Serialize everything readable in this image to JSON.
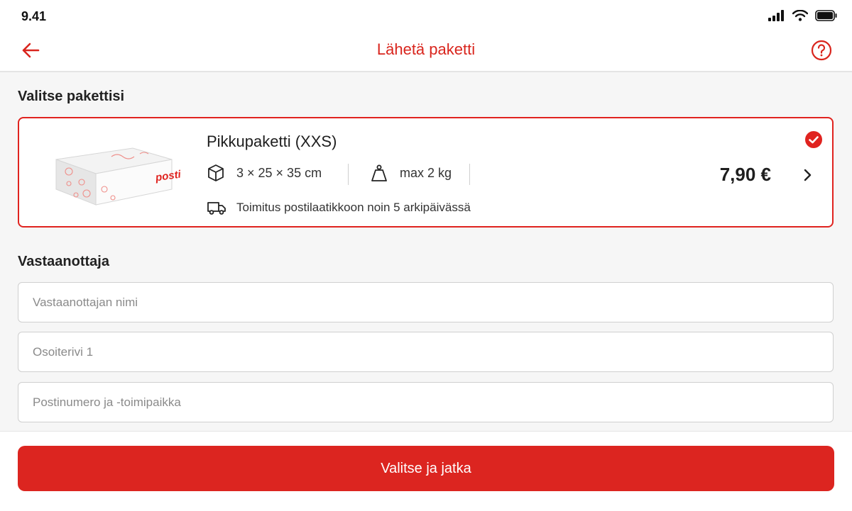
{
  "status_bar": {
    "time": "9.41"
  },
  "nav": {
    "title": "Lähetä paketti",
    "back_icon": "arrow-left-icon",
    "help_icon": "question-circle-icon"
  },
  "colors": {
    "accent": "#dc2520",
    "border": "#e0231f"
  },
  "package_section": {
    "title": "Valitse pakettisi",
    "package": {
      "name": "Pikkupaketti (XXS)",
      "dimensions": "3 × 25 × 35 cm",
      "weight": "max 2 kg",
      "delivery": "Toimitus postilaatikkoon noin 5 arkipäivässä",
      "price": "7,90 €",
      "box_brand": "posti",
      "selected": true
    }
  },
  "recipient_section": {
    "title": "Vastaanottaja",
    "fields": {
      "name": {
        "placeholder": "Vastaanottajan nimi",
        "value": ""
      },
      "address": {
        "placeholder": "Osoiterivi 1",
        "value": ""
      },
      "postal": {
        "placeholder": "Postinumero ja -toimipaikka",
        "value": ""
      }
    }
  },
  "footer": {
    "cta_label": "Valitse ja jatka"
  }
}
